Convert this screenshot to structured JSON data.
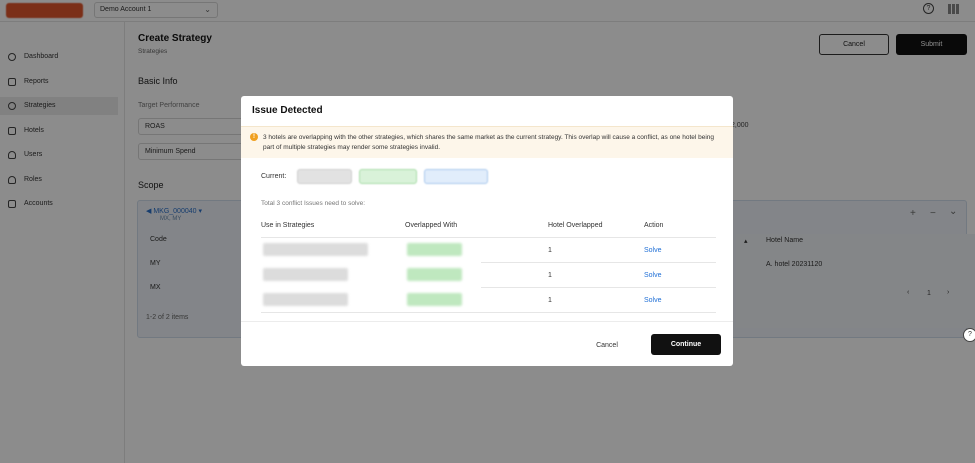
{
  "topbar": {
    "account": "Demo Account 1",
    "help_glyph": "?"
  },
  "sidebar": {
    "items": [
      {
        "label": "Dashboard",
        "icon": "dashboard-icon"
      },
      {
        "label": "Reports",
        "icon": "reports-icon"
      },
      {
        "label": "Strategies",
        "icon": "strategies-icon",
        "active": true
      },
      {
        "label": "Hotels",
        "icon": "hotels-icon"
      },
      {
        "label": "Users",
        "icon": "users-icon"
      },
      {
        "label": "Roles",
        "icon": "roles-icon"
      },
      {
        "label": "Accounts",
        "icon": "accounts-icon"
      }
    ]
  },
  "page": {
    "title": "Create Strategy",
    "breadcrumb": "Strategies",
    "cancel_label": "Cancel",
    "submit_label": "Submit",
    "basic_info_title": "Basic Info",
    "target_label": "Target Performance",
    "target_value": "ROAS",
    "min_spend_value": "Minimum Spend",
    "partial_value": "2,000",
    "scope_title": "Scope",
    "scope_header": "MKG_000040 ▾",
    "scope_header_sub": "MX, MY",
    "col_code": "Code",
    "row1_code": "MY",
    "row2_code": "MX",
    "pagination_text": "1-2 of 2 items",
    "hotel_name_header": "Hotel Name",
    "hotel_name_value": "A. hotel 20231120",
    "page_number": "1",
    "ctrl_add": "+",
    "ctrl_remove": "−",
    "ctrl_collapse": "⌄",
    "prev": "‹",
    "next": "›"
  },
  "modal": {
    "title": "Issue Detected",
    "warning": "3 hotels are overlapping with the other strategies, which shares the same market as the current strategy. This overlap will cause a conflict, as one hotel being part of multiple strategies may render some strategies invalid.",
    "current_label": "Current:",
    "total_text": "Total 3 conflict Issues need to solve:",
    "columns": {
      "use_in": "Use in Strategies",
      "overlapped_with": "Overlapped With",
      "hotel_overlapped": "Hotel Overlapped",
      "action": "Action"
    },
    "rows": [
      {
        "hotel_count": "1",
        "action": "Solve"
      },
      {
        "hotel_count": "1",
        "action": "Solve"
      },
      {
        "hotel_count": "1",
        "action": "Solve"
      }
    ],
    "cancel_label": "Cancel",
    "continue_label": "Continue"
  },
  "colors": {
    "accent_link": "#1f6fd6",
    "primary_button": "#111111",
    "warning": "#f0a020"
  }
}
